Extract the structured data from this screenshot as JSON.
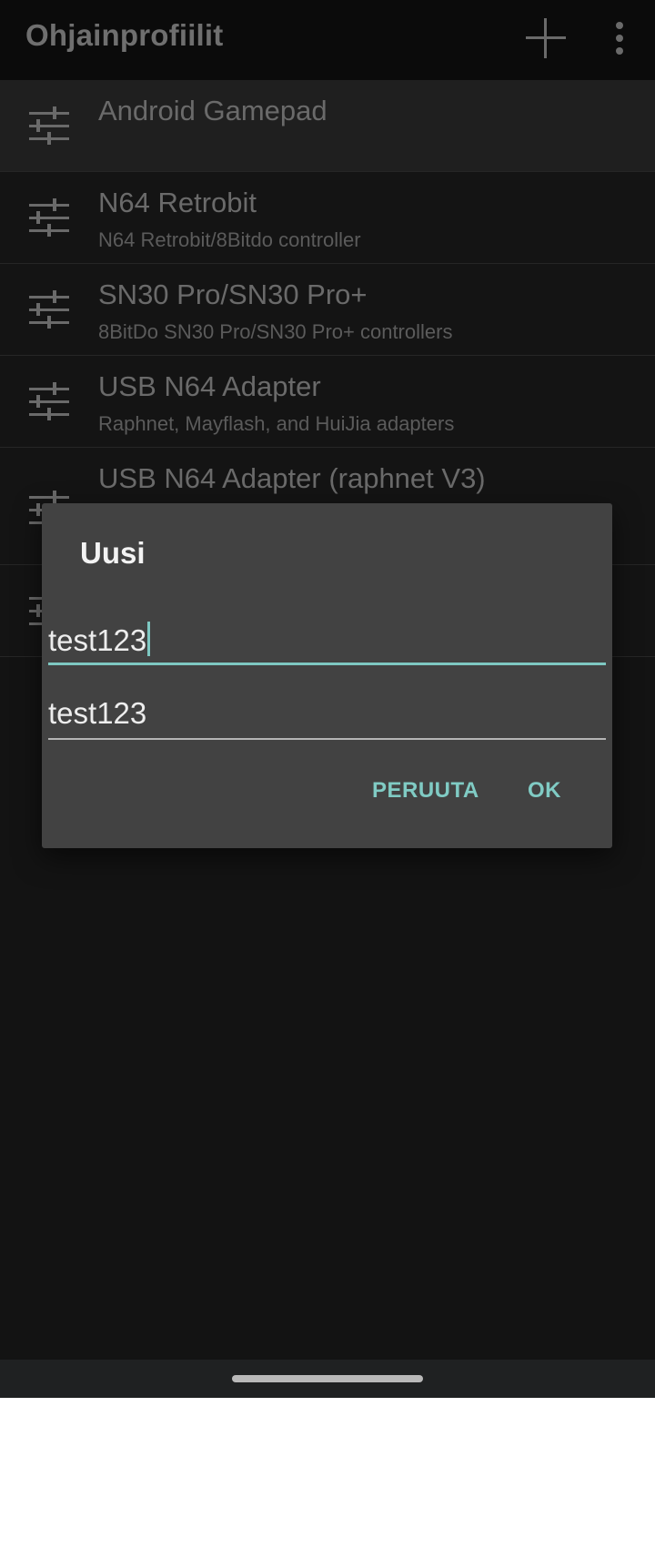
{
  "app": {
    "title": "Ohjainprofiilit",
    "add_icon": "plus-icon",
    "menu_icon": "more-vert-icon"
  },
  "profiles": [
    {
      "name": "Android Gamepad",
      "desc": "",
      "selected": true,
      "icon": "tune-sliders-icon"
    },
    {
      "name": "N64 Retrobit",
      "desc": "N64 Retrobit/8Bitdo controller",
      "icon": "tune-sliders-icon"
    },
    {
      "name": "SN30 Pro/SN30 Pro+",
      "desc": "8BitDo SN30 Pro/SN30 Pro+ controllers",
      "icon": "tune-sliders-icon"
    },
    {
      "name": "USB N64 Adapter",
      "desc": "Raphnet, Mayflash, and HuiJia adapters",
      "icon": "tune-sliders-icon"
    },
    {
      "name": "USB N64 Adapter (raphnet V3)",
      "desc": "",
      "icon": "tune-sliders-icon"
    },
    {
      "name": "",
      "desc": "",
      "icon": "tune-sliders-icon"
    }
  ],
  "dialog": {
    "title": "Uusi",
    "name_value": "test123",
    "desc_value": "test123",
    "cancel_label": "PERUUTA",
    "ok_label": "OK"
  },
  "colors": {
    "accent": "#80cbc4",
    "dialog_bg": "#424242",
    "screen_bg": "#131313"
  }
}
